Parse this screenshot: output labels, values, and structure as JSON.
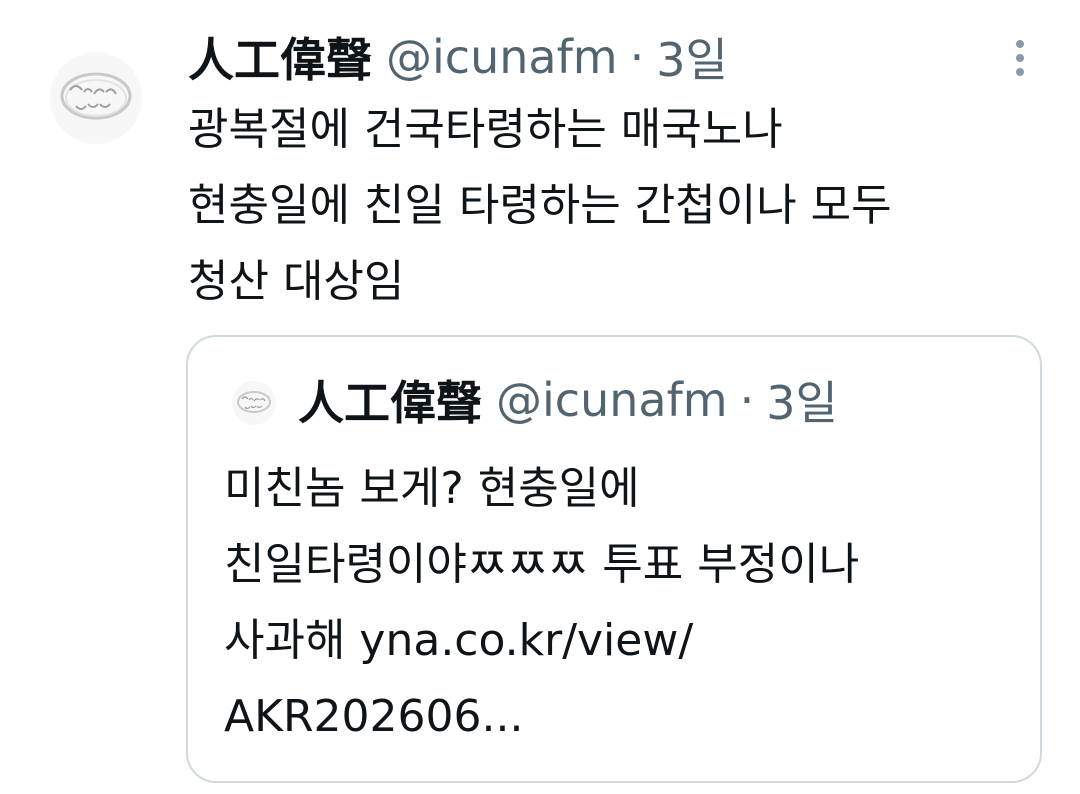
{
  "tweet": {
    "display_name": "人工偉聲",
    "handle": "@icunafm",
    "separator": "·",
    "time": "3일",
    "avatar_icon": "ring-avatar-icon",
    "more_icon": "more-options-icon",
    "text_lines": [
      "광복절에 건국타령하는 매국노나",
      "현충일에 친일 타령하는 간첩이나 모두",
      "청산 대상임"
    ]
  },
  "quote": {
    "display_name": "人工偉聲",
    "handle": "@icunafm",
    "separator": "·",
    "time": "3일",
    "text_lines": [
      "미친놈 보게? 현충일에",
      "친일타령이야ㅉㅉㅉ 투표 부정이나",
      "사과해  yna.co.kr/view/",
      "AKR202606..."
    ]
  },
  "colors": {
    "primary_text": "#0f1419",
    "secondary_text": "#536471",
    "card_border": "#cfd9de",
    "more_dots": "#8b98a5"
  }
}
